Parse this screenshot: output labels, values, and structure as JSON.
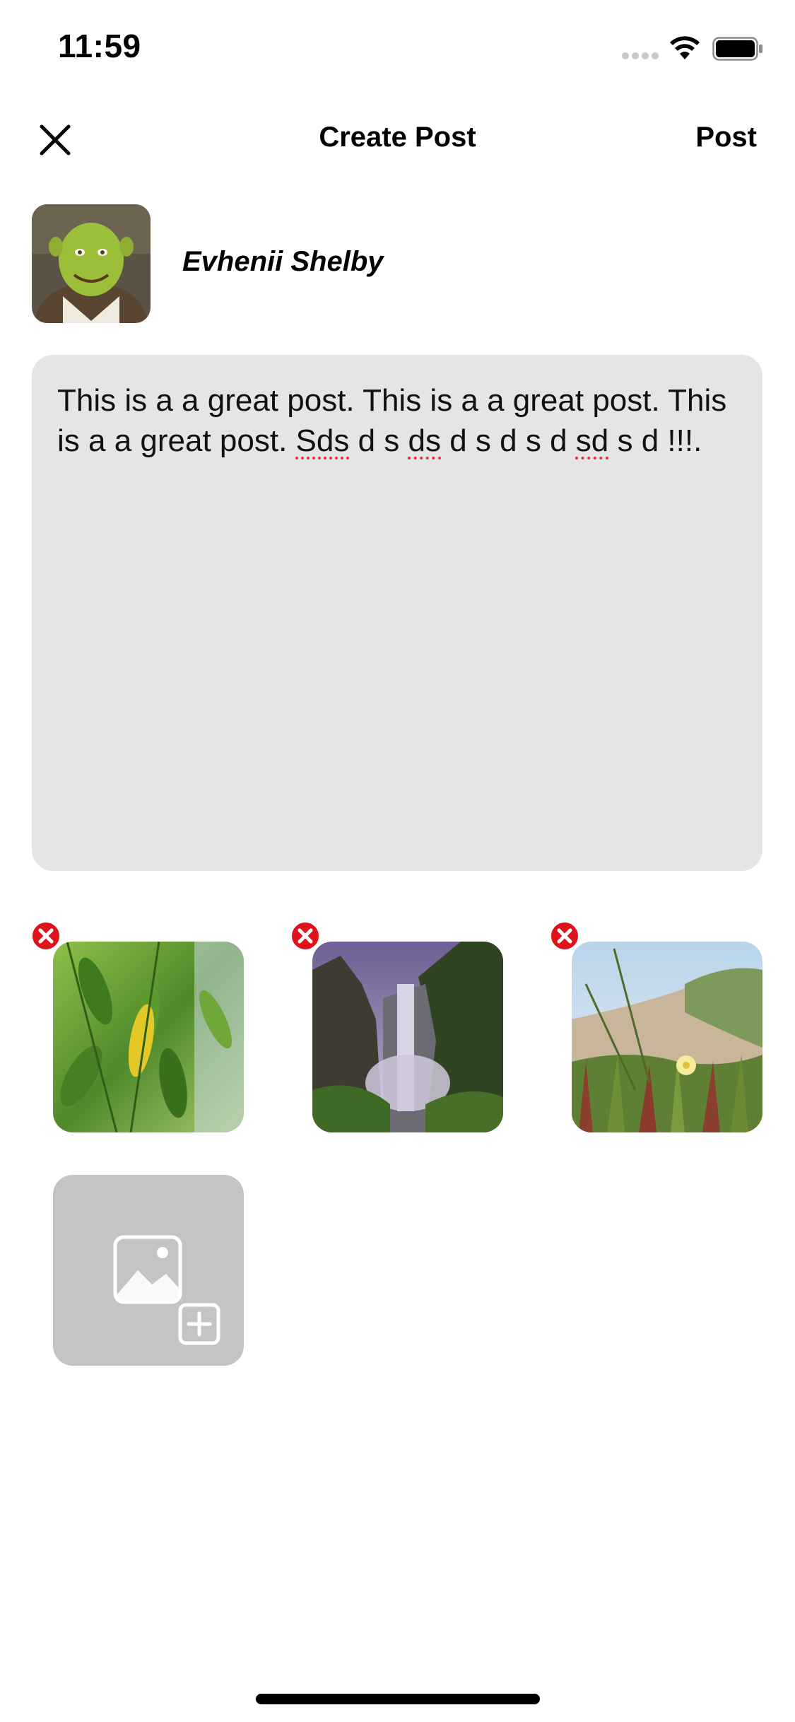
{
  "status_bar": {
    "time": "11:59",
    "signal_icon": "cellular-signal-icon",
    "wifi_icon": "wifi-icon",
    "battery_icon": "battery-icon"
  },
  "nav": {
    "close_icon": "close-icon",
    "title": "Create Post",
    "post_label": "Post"
  },
  "author": {
    "name": "Evhenii Shelby",
    "avatar_icon": "avatar"
  },
  "post": {
    "text_before": "This is a a great post. This is a a great post. This is a a great post. ",
    "misspelled_1": "Sds",
    "text_mid_1": " d s ",
    "misspelled_2": "ds",
    "text_mid_2": " d s d s d ",
    "misspelled_3": "sd",
    "text_after": " s d !!!."
  },
  "attachments": [
    {
      "subject": "green leaves photo",
      "remove_icon": "remove-circle-icon"
    },
    {
      "subject": "waterfall photo",
      "remove_icon": "remove-circle-icon"
    },
    {
      "subject": "beach grass flower photo",
      "remove_icon": "remove-circle-icon"
    }
  ],
  "add_photo": {
    "icon": "add-photo-icon"
  },
  "colors": {
    "text_area_bg": "#e5e5e5",
    "add_photo_bg": "#c4c4c4",
    "remove_red": "#e0131d"
  }
}
